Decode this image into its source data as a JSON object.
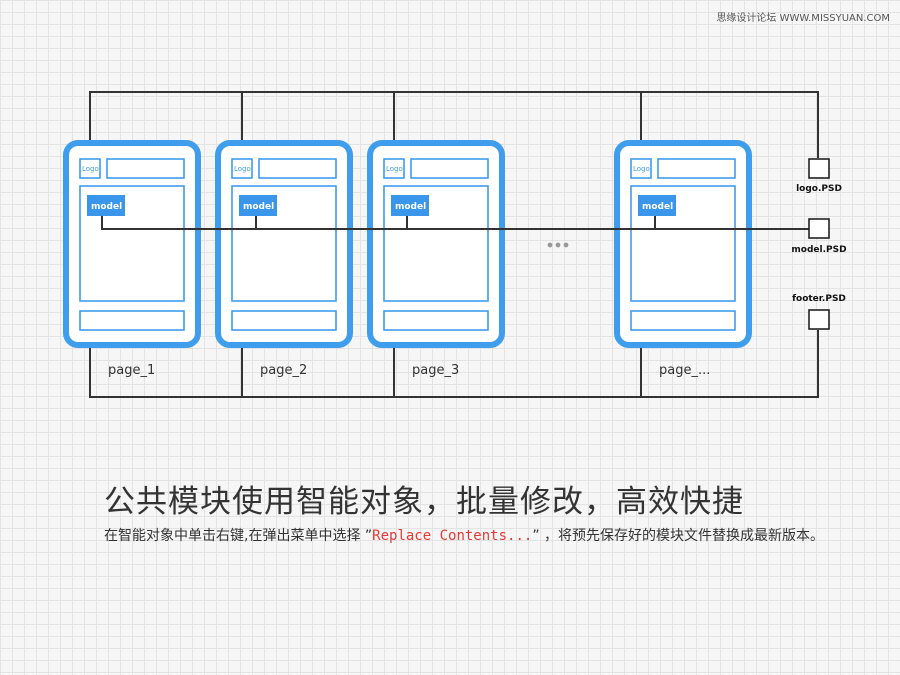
{
  "watermark": "思缘设计论坛 WWW.MISSYUAN.COM",
  "diagram": {
    "pages": [
      {
        "label": "page_1",
        "logo": "Logo",
        "model": "model"
      },
      {
        "label": "page_2",
        "logo": "Logo",
        "model": "model"
      },
      {
        "label": "page_3",
        "logo": "Logo",
        "model": "model"
      },
      {
        "label": "page_...",
        "logo": "Logo",
        "model": "model"
      }
    ],
    "modules": {
      "logo": "logo.PSD",
      "model": "model.PSD",
      "footer": "footer.PSD"
    },
    "ellipsis": "•••"
  },
  "text": {
    "headline": "公共模块使用智能对象，批量修改，高效快捷",
    "desc_before": "在智能对象中单击右键,在弹出菜单中选择 ”",
    "desc_highlight": "Replace Contents...",
    "desc_after": "” ，将预先保存好的模块文件替换成最新版本。"
  },
  "colors": {
    "accent": "#3f9ded",
    "highlight": "#e53935",
    "wire": "#333333"
  }
}
